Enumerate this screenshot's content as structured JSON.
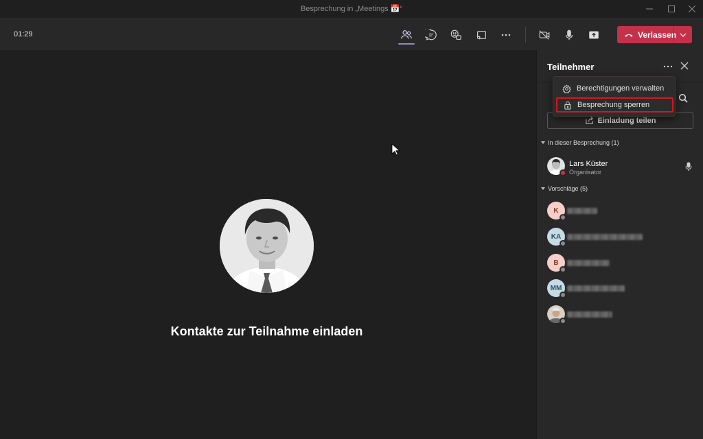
{
  "window": {
    "title": "Besprechung in „Meetings 📅“"
  },
  "toolbar": {
    "timer": "01:29",
    "leave_label": "Verlassen",
    "icons": [
      "people-icon",
      "chat-icon",
      "reactions-icon",
      "share-tray-icon",
      "more-icon",
      "camera-off-icon",
      "mic-icon",
      "share-screen-icon"
    ]
  },
  "stage": {
    "invite_text": "Kontakte zur Teilnahme einladen"
  },
  "panel": {
    "title": "Teilnehmer",
    "share_invite_label": "Einladung teilen",
    "in_meeting_label": "In dieser Besprechung (1)",
    "suggestions_label": "Vorschläge (5)",
    "participants": [
      {
        "name": "Lars Küster",
        "role": "Organisator"
      }
    ],
    "suggestions": [
      {
        "initials": "K",
        "bg": "#f5cfc9",
        "fg": "#8a3b2c"
      },
      {
        "initials": "KA",
        "bg": "#c7dbe4",
        "fg": "#2b4f61"
      },
      {
        "initials": "B",
        "bg": "#f5cfc9",
        "fg": "#8a3b2c"
      },
      {
        "initials": "MM",
        "bg": "#c7dbe4",
        "fg": "#2b4f61"
      },
      {
        "initials": "",
        "bg": "#9a8a7a",
        "fg": "#ffffff"
      }
    ]
  },
  "menu": {
    "items": [
      {
        "label": "Berechtigungen verwalten"
      },
      {
        "label": "Besprechung sperren"
      }
    ]
  },
  "colors": {
    "accent": "#8b8cc7",
    "leave": "#c4314b",
    "highlight": "#d1181f"
  }
}
